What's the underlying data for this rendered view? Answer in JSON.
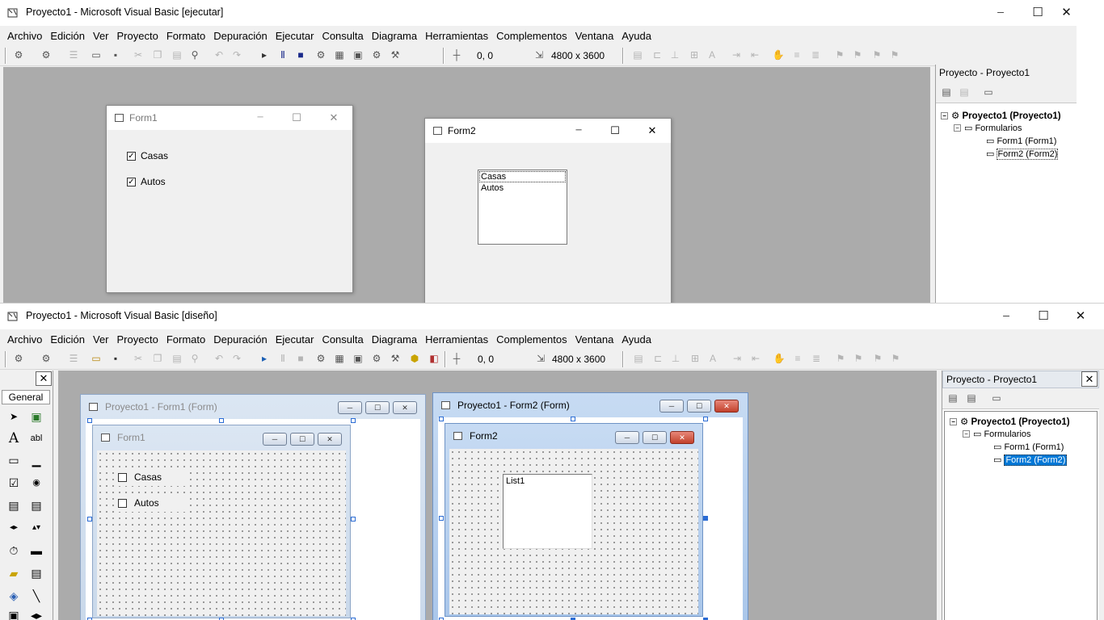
{
  "run_window": {
    "title": "Proyecto1 - Microsoft Visual Basic [ejecutar]",
    "coords": "0, 0",
    "size": "4800 x 3600"
  },
  "design_window": {
    "title": "Proyecto1 - Microsoft Visual Basic [diseño]",
    "coords": "0, 0",
    "size": "4800 x 3600"
  },
  "menu": [
    "Archivo",
    "Edición",
    "Ver",
    "Proyecto",
    "Formato",
    "Depuración",
    "Ejecutar",
    "Consulta",
    "Diagrama",
    "Herramientas",
    "Complementos",
    "Ventana",
    "Ayuda"
  ],
  "project_explorer": {
    "caption": "Proyecto - Proyecto1",
    "root": "Proyecto1 (Proyecto1)",
    "folder": "Formularios",
    "items": [
      "Form1 (Form1)",
      "Form2 (Form2)"
    ]
  },
  "runtime_form1": {
    "title": "Form1",
    "checkboxes": [
      {
        "label": "Casas",
        "checked": true
      },
      {
        "label": "Autos",
        "checked": true
      }
    ]
  },
  "runtime_form2": {
    "title": "Form2",
    "list_items": [
      "Casas",
      "Autos"
    ]
  },
  "toolbox": {
    "tab": "General"
  },
  "design_form1": {
    "window_title": "Proyecto1 - Form1 (Form)",
    "form_title": "Form1",
    "checkboxes": [
      "Casas",
      "Autos"
    ]
  },
  "design_form2": {
    "window_title": "Proyecto1 - Form2 (Form)",
    "form_title": "Form2",
    "listbox_label": "List1"
  },
  "glyphs": {
    "minimize": "─",
    "maximize": "☐",
    "close": "✕",
    "check": "✓",
    "pointer": "➤"
  },
  "colors": {
    "mdi_background": "#ababab",
    "selection": "#0078d7",
    "close_button": "#c2412c"
  }
}
